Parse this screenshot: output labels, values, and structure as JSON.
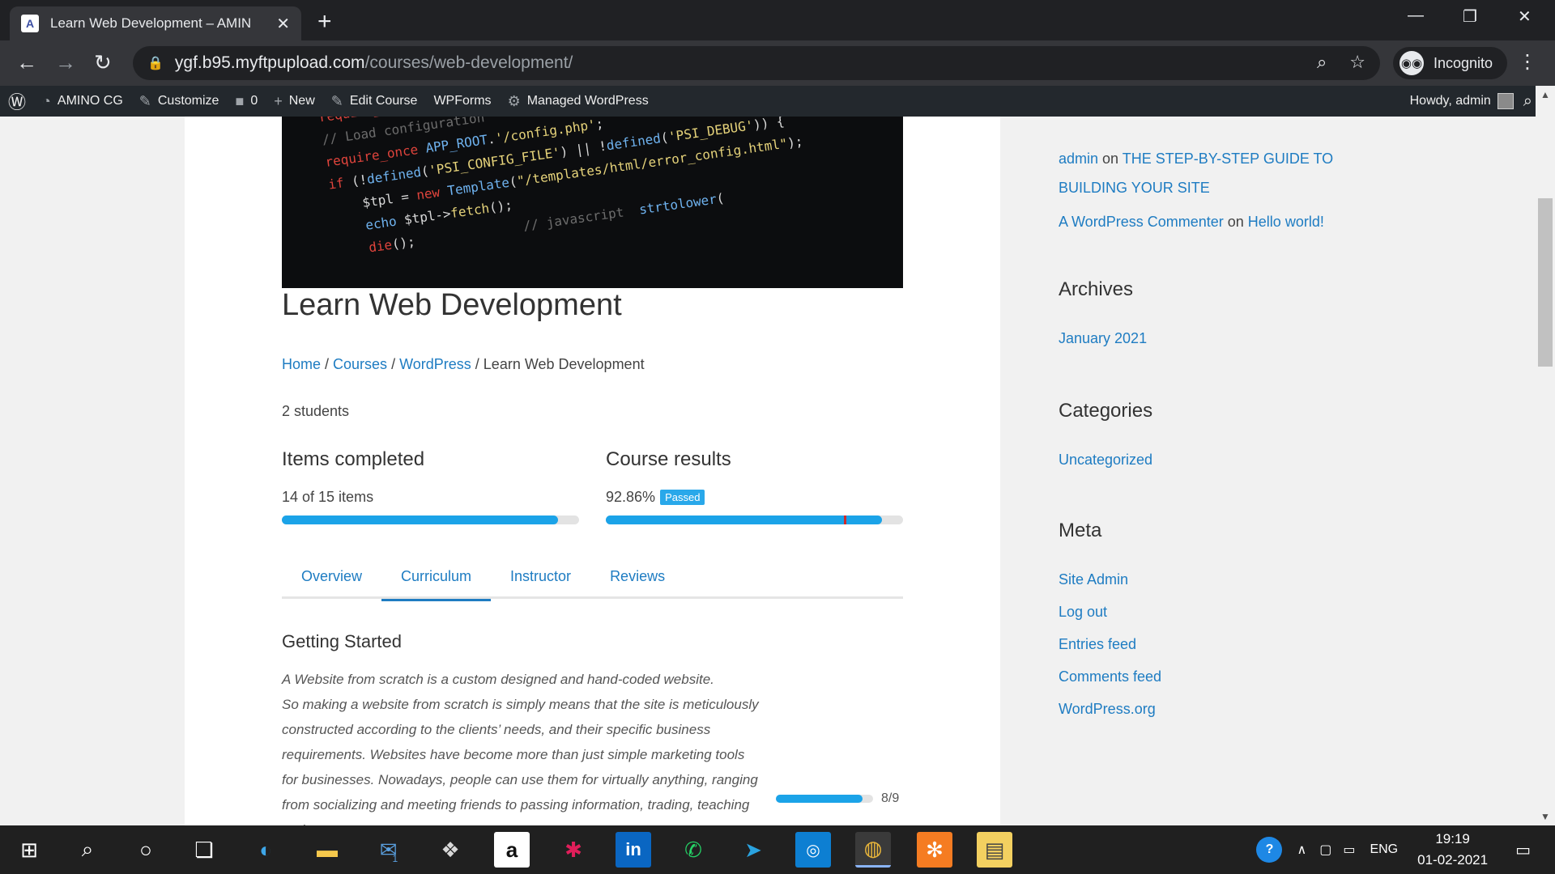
{
  "browser": {
    "tab_title": "Learn Web Development – AMIN",
    "tab_favicon": "A",
    "url_host": "ygf.b95.myftpupload.com",
    "url_path": "/courses/web-development/",
    "incognito_label": "Incognito"
  },
  "adminbar": {
    "site_name": "AMINO CG",
    "customize": "Customize",
    "comments_count": "0",
    "new": "New",
    "edit_course": "Edit Course",
    "wpforms": "WPForms",
    "managed_wp": "Managed WordPress",
    "howdy": "Howdy, admin"
  },
  "course": {
    "title": "Learn Web Development",
    "breadcrumb": {
      "home": "Home",
      "courses": "Courses",
      "category": "WordPress",
      "current": "Learn Web Development",
      "sep": " / "
    },
    "students": "2 students",
    "items_completed": {
      "heading": "Items completed",
      "text": "14 of 15 items",
      "fraction": 0.93
    },
    "course_results": {
      "heading": "Course results",
      "percent_text": "92.86%",
      "badge": "Passed",
      "fraction": 0.9286,
      "passing_fraction": 0.8
    },
    "tabs": [
      "Overview",
      "Curriculum",
      "Instructor",
      "Reviews"
    ],
    "active_tab": "Curriculum",
    "section": {
      "title": "Getting Started",
      "desc_line1": "A Website from scratch is a custom designed and hand-coded website.",
      "desc_rest": "So making a website from scratch is simply means that the site is meticulously constructed according to the clients’ needs, and their specific business requirements. Websites have become more than just simple marketing tools for businesses. Nowadays, people can use them for virtually anything, ranging from socializing and meeting friends to passing information, trading, teaching and",
      "progress_text": "8/9",
      "progress_fraction": 0.89
    }
  },
  "sidebar": {
    "recent_comments": [
      {
        "author": "admin",
        "on": "on",
        "post": "THE STEP-BY-STEP GUIDE TO BUILDING YOUR SITE"
      },
      {
        "author": "A WordPress Commenter",
        "on": "on",
        "post": "Hello world!"
      }
    ],
    "archives_title": "Archives",
    "archives": [
      "January 2021"
    ],
    "categories_title": "Categories",
    "categories": [
      "Uncategorized"
    ],
    "meta_title": "Meta",
    "meta": [
      "Site Admin",
      "Log out",
      "Entries feed",
      "Comments feed",
      "WordPress.org"
    ]
  },
  "taskbar": {
    "language": "ENG",
    "time": "19:19",
    "date": "01-02-2021",
    "mail_badge": "1"
  },
  "colors": {
    "link": "#1e7cc2",
    "progress": "#1ba3e8",
    "passed_badge": "#29a8ea",
    "passing_mark": "#d02a2a"
  }
}
